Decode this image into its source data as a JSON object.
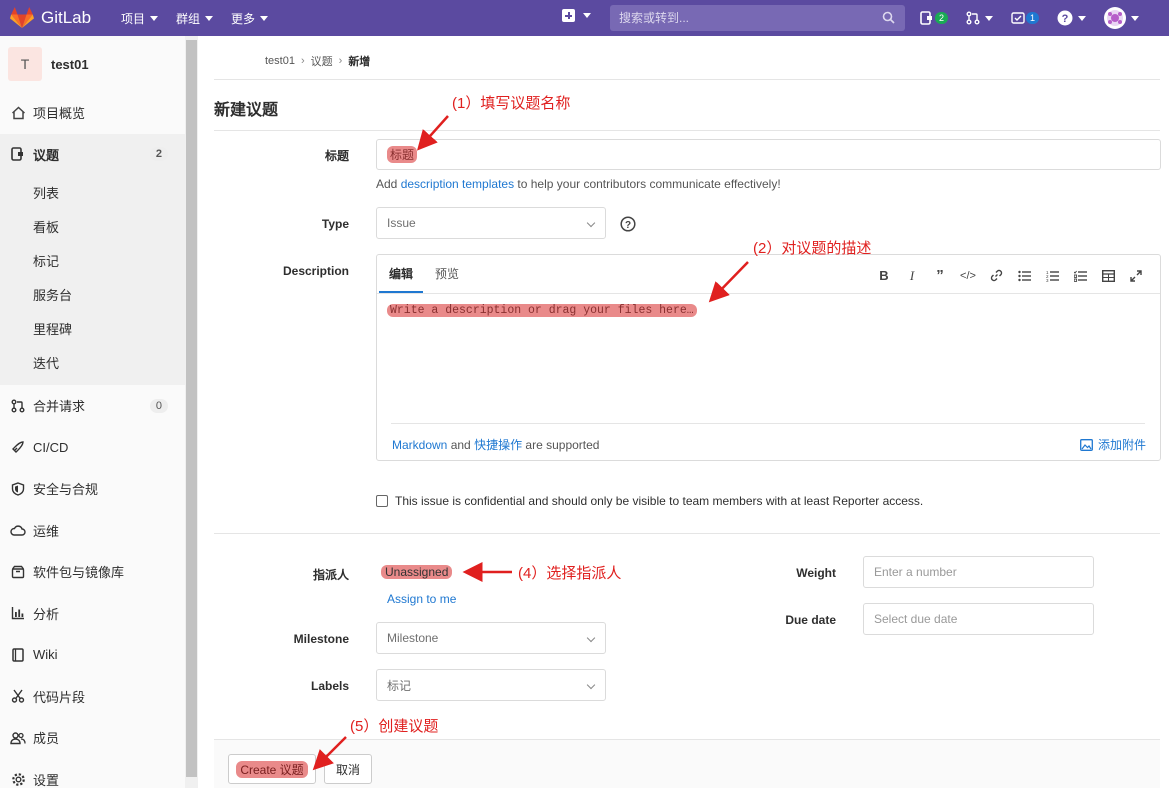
{
  "navbar": {
    "brand": "GitLab",
    "menu": [
      {
        "label": "项目"
      },
      {
        "label": "群组"
      },
      {
        "label": "更多"
      }
    ],
    "search_placeholder": "搜索或转到...",
    "todos_count": "2",
    "issues_count": "1",
    "icons": [
      "gitlab-logo-icon",
      "plus-icon",
      "search-icon",
      "todo-icon",
      "merge-request-icon",
      "issues-icon",
      "help-icon",
      "avatar-icon"
    ]
  },
  "sidebar": {
    "project_initial": "T",
    "project_name": "test01",
    "items": [
      {
        "label": "项目概览",
        "icon": "home-icon"
      },
      {
        "label": "议题",
        "icon": "issues-icon",
        "count": "2"
      },
      {
        "label": "合并请求",
        "icon": "merge-request-icon",
        "count": "0"
      },
      {
        "label": "CI/CD",
        "icon": "rocket-icon"
      },
      {
        "label": "安全与合规",
        "icon": "shield-icon"
      },
      {
        "label": "运维",
        "icon": "cloud-icon"
      },
      {
        "label": "软件包与镜像库",
        "icon": "package-icon"
      },
      {
        "label": "分析",
        "icon": "chart-icon"
      },
      {
        "label": "Wiki",
        "icon": "book-icon"
      },
      {
        "label": "代码片段",
        "icon": "scissors-icon"
      },
      {
        "label": "成员",
        "icon": "users-icon"
      },
      {
        "label": "设置",
        "icon": "gear-icon"
      }
    ],
    "sub_items": [
      "列表",
      "看板",
      "标记",
      "服务台",
      "里程碑",
      "迭代"
    ]
  },
  "breadcrumb": [
    "test01",
    "议题",
    "新增"
  ],
  "page_title": "新建议题",
  "form": {
    "title_label": "标题",
    "title_placeholder": "标题",
    "templates_hint_prefix": "Add ",
    "templates_hint_link": "description templates",
    "templates_hint_suffix": " to help your contributors communicate effectively!",
    "type_label": "Type",
    "type_value": "Issue",
    "description_label": "Description",
    "tab_edit": "编辑",
    "tab_preview": "预览",
    "toolbar": [
      "B",
      "I",
      "99",
      "</>",
      "link",
      "bullet-list",
      "numbered-list",
      "task-list",
      "table",
      "fullscreen"
    ],
    "description_placeholder": "Write a description or drag your files here…",
    "markdown_link": "Markdown",
    "and_text": " and ",
    "shortcuts_link": "快捷操作",
    "supported_text": " are supported",
    "attach_label": "添加附件",
    "confidential_text": "This issue is confidential and should only be visible to team members with at least Reporter access.",
    "assignee_label": "指派人",
    "assignee_value": "Unassigned",
    "assign_to_me": "Assign to me",
    "milestone_label": "Milestone",
    "milestone_value": "Milestone",
    "labels_label": "Labels",
    "labels_value": "标记",
    "weight_label": "Weight",
    "weight_placeholder": "Enter a number",
    "due_date_label": "Due date",
    "due_date_placeholder": "Select due date",
    "create_button": "Create 议题",
    "cancel_button": "取消"
  },
  "annotations": {
    "a1": "(1）填写议题名称",
    "a2": "(2）对议题的描述",
    "a4": "(4）选择指派人",
    "a5": "(5）创建议题"
  },
  "colors": {
    "navbar": "#5b4aa0",
    "highlight": "#e98a8a",
    "annotation": "#e0201f",
    "link": "#1f78d1"
  }
}
